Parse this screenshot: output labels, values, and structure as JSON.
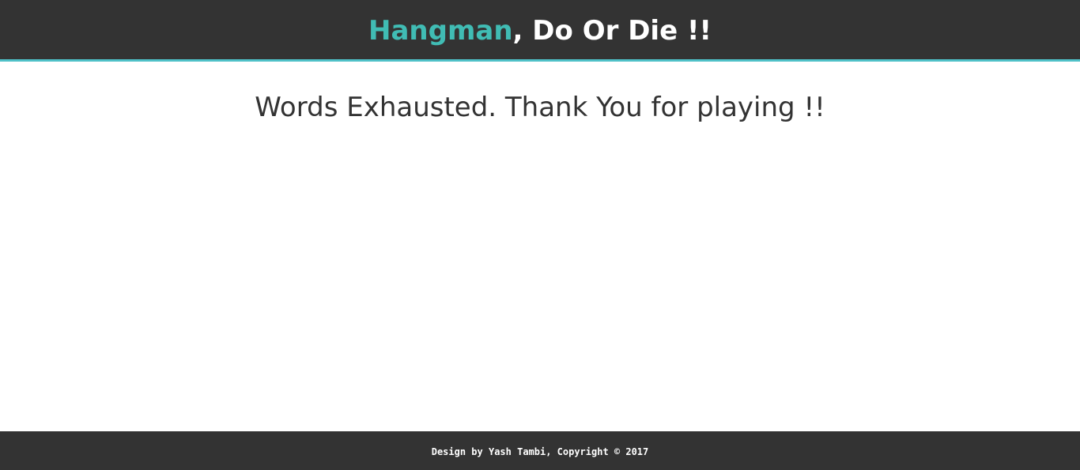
{
  "header": {
    "brand": "Hangman",
    "tagline": ", Do Or Die !!"
  },
  "main": {
    "message": "Words Exhausted. Thank You for playing !!"
  },
  "footer": {
    "text": "Design by Yash Tambi, Copyright © 2017"
  },
  "colors": {
    "header_bg": "#333333",
    "accent": "#40bcb4",
    "header_border": "#4fc1c8",
    "text_dark": "#333333",
    "page_bg": "#ffffff"
  }
}
